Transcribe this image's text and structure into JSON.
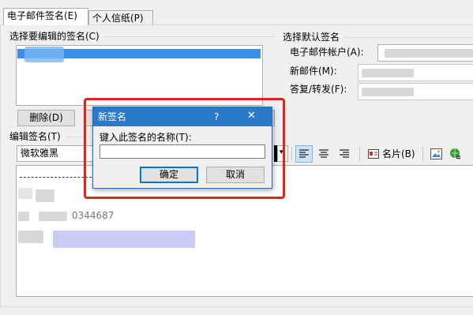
{
  "tabs": [
    {
      "label": "电子邮件签名(E)",
      "active": true
    },
    {
      "label": "个人信纸(P)",
      "active": false
    }
  ],
  "select_signature": {
    "label": "选择要编辑的签名(C)"
  },
  "delete_button": {
    "label": "删除(D)"
  },
  "default_signature": {
    "heading": "选择默认签名",
    "email_account_label": "电子邮件帐户(A):",
    "new_message_label": "新邮件(M):",
    "reply_forward_label": "答复/转发(F):"
  },
  "edit_signature": {
    "label": "编辑签名(T)",
    "font_name": "微软雅黑",
    "business_card_label": "名片(B)"
  },
  "editor": {
    "partial_text": "0344687"
  },
  "dialog": {
    "title": "新签名",
    "help": "?",
    "close": "✕",
    "prompt": "键入此签名的名称(T):",
    "input_value": "",
    "ok_label": "确定",
    "cancel_label": "取消"
  },
  "colors": {
    "dialog_title": "#2b79c9",
    "highlight": "#e2241c",
    "selection": "#3a8fe8"
  }
}
